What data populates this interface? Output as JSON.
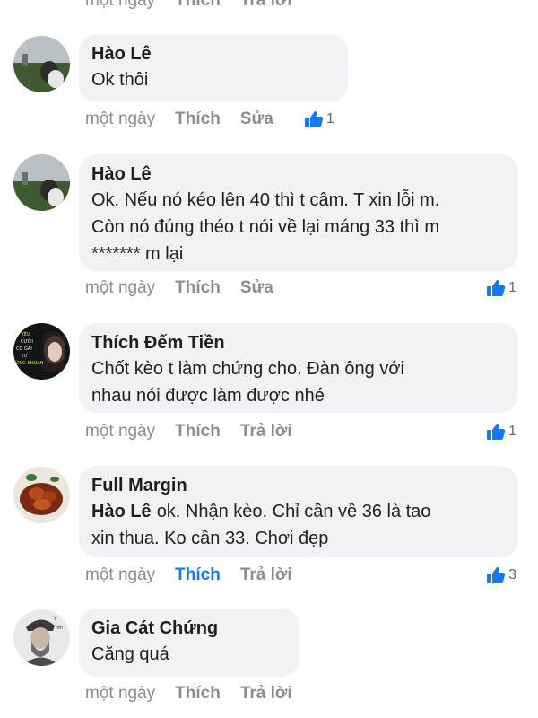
{
  "top_actions": {
    "time": "một ngày",
    "like": "Thích",
    "reply": "Trả lời"
  },
  "comments": [
    {
      "author": "Hào Lê",
      "text": "Ok thôi",
      "time": "một ngày",
      "like_label": "Thích",
      "action_label": "Sửa",
      "likes": "1"
    },
    {
      "author": "Hào Lê",
      "text_lines": [
        "Ok. Nếu nó kéo lên 40 thì t câm. T xin lỗi m.",
        "Còn nó đúng théo t nói về lại máng 33 thì m",
        "******* m lại"
      ],
      "time": "một ngày",
      "like_label": "Thích",
      "action_label": "Sửa",
      "likes": "1"
    },
    {
      "author": "Thích Đếm Tiền",
      "text_lines": [
        "Chốt kèo t làm chứng cho. Đàn ông với",
        "nhau nói được làm được nhé"
      ],
      "time": "một ngày",
      "like_label": "Thích",
      "action_label": "Trả lời",
      "likes": "1",
      "avatar_caption": [
        "Y YÊU",
        "CƯỚI",
        "CÔ GÁI",
        "IỰ",
        "ỨNG KHOÁN"
      ]
    },
    {
      "author": "Full Margin",
      "mention": "Hào Lê",
      "text_lines": [
        "ok. Nhận kèo. Chỉ cần về 36 là tao",
        "xin thua. Ko cần 33. Chơi đẹp"
      ],
      "time": "một ngày",
      "like_label": "Thích",
      "action_label": "Trả lời",
      "likes": "3",
      "liked_by_me": true
    },
    {
      "author": "Gia Cát Chứng",
      "text": "Căng quá",
      "time": "một ngày",
      "like_label": "Thích",
      "action_label": "Trả lời",
      "likes": "",
      "avatar_caption": [
        "Y",
        "Trm"
      ]
    }
  ],
  "colors": {
    "bubble": "#f0f2f5",
    "accent": "#1877f2",
    "meta": "#8a8d91"
  }
}
